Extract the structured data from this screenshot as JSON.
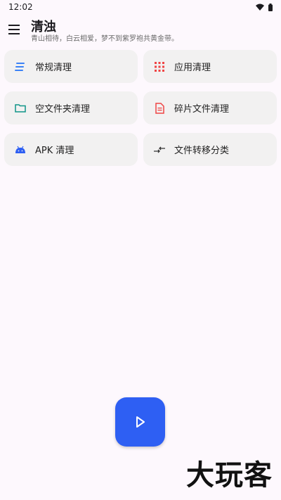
{
  "status_bar": {
    "time": "12:02"
  },
  "app_bar": {
    "title": "清浊",
    "subtitle": "青山相待，白云相爱，梦不到紫罗袍共黄金带。"
  },
  "cards": [
    {
      "label": "常规清理",
      "icon": "lines-icon",
      "color": "#3b82f6"
    },
    {
      "label": "应用清理",
      "icon": "apps-grid-icon",
      "color": "#ef4444"
    },
    {
      "label": "空文件夹清理",
      "icon": "folder-icon",
      "color": "#0f9488"
    },
    {
      "label": "碎片文件清理",
      "icon": "document-icon",
      "color": "#ef4444"
    },
    {
      "label": "APK 清理",
      "icon": "android-icon",
      "color": "#2e5ff3"
    },
    {
      "label": "文件转移分类",
      "icon": "transfer-icon",
      "color": "#333333"
    }
  ],
  "fab": {
    "icon": "play-icon",
    "color": "#2e5ff3"
  },
  "watermark": "大玩客"
}
